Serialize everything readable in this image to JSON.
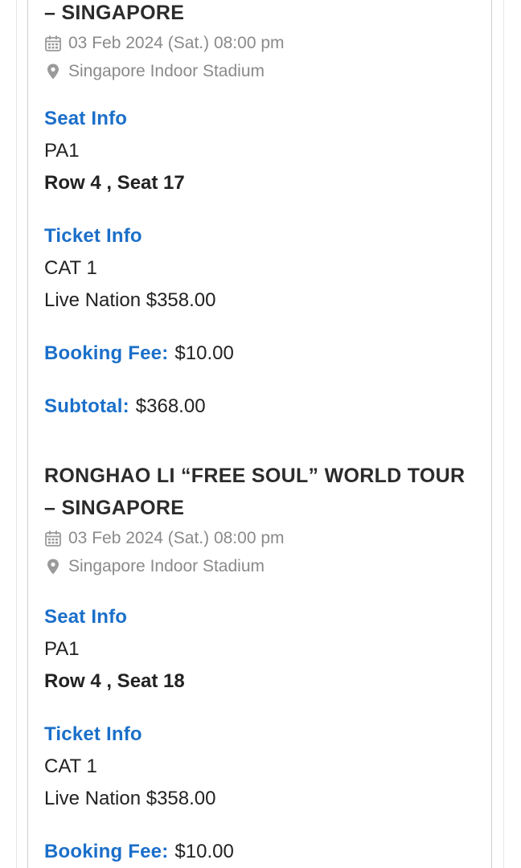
{
  "tickets": [
    {
      "title_line_2": "– SINGAPORE",
      "date": "03 Feb 2024 (Sat.) 08:00 pm",
      "venue": "Singapore Indoor Stadium",
      "seat_info_label": "Seat Info",
      "section": "PA1",
      "row_seat": "Row 4 , Seat 17",
      "ticket_info_label": "Ticket Info",
      "category": "CAT 1",
      "price_line": "Live Nation $358.00",
      "booking_fee_label": "Booking Fee:",
      "booking_fee": "$10.00",
      "subtotal_label": "Subtotal:",
      "subtotal": "$368.00"
    },
    {
      "title_line_1": "RONGHAO LI “FREE SOUL” WORLD TOUR",
      "title_line_2": "– SINGAPORE",
      "date": "03 Feb 2024 (Sat.) 08:00 pm",
      "venue": "Singapore Indoor Stadium",
      "seat_info_label": "Seat Info",
      "section": "PA1",
      "row_seat": "Row 4 , Seat 18",
      "ticket_info_label": "Ticket Info",
      "category": "CAT 1",
      "price_line": "Live Nation $358.00",
      "booking_fee_label": "Booking Fee:",
      "booking_fee": "$10.00"
    }
  ],
  "icons": {
    "date": "calendar-icon",
    "venue": "map-pin-icon"
  },
  "colors": {
    "accent": "#1b6fc9",
    "text": "#222222",
    "muted": "#8a8a8a",
    "border": "#cfcfcf"
  }
}
